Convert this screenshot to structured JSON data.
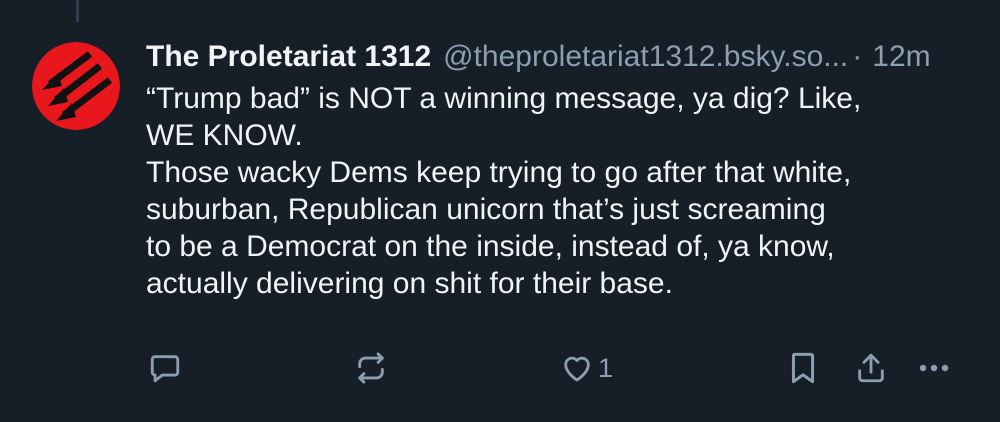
{
  "post": {
    "author": {
      "display_name": "The Proletariat 1312",
      "handle": "@theproletariat1312.bsky.so...",
      "avatar_icon": "three-arrows-icon",
      "avatar_color": "#e8171b"
    },
    "separator": "·",
    "time": "12m",
    "text_lines": [
      "“Trump bad” is NOT a winning message, ya dig? Like,",
      "WE KNOW.",
      "Those wacky Dems keep trying to go after that white,",
      "suburban, Republican unicorn that’s just screaming",
      "to be a Democrat on the inside, instead of, ya know,",
      "actually delivering on shit for their base."
    ],
    "actions": {
      "reply_icon": "reply-bubble-icon",
      "repost_icon": "repost-icon",
      "like_icon": "heart-icon",
      "like_count": "1",
      "bookmark_icon": "bookmark-icon",
      "share_icon": "share-icon",
      "more_icon": "more-dots-icon"
    }
  },
  "colors": {
    "background": "#161e27",
    "text": "#f1f3f5",
    "muted": "#8c9eb2",
    "thread_line": "#2e4052"
  }
}
